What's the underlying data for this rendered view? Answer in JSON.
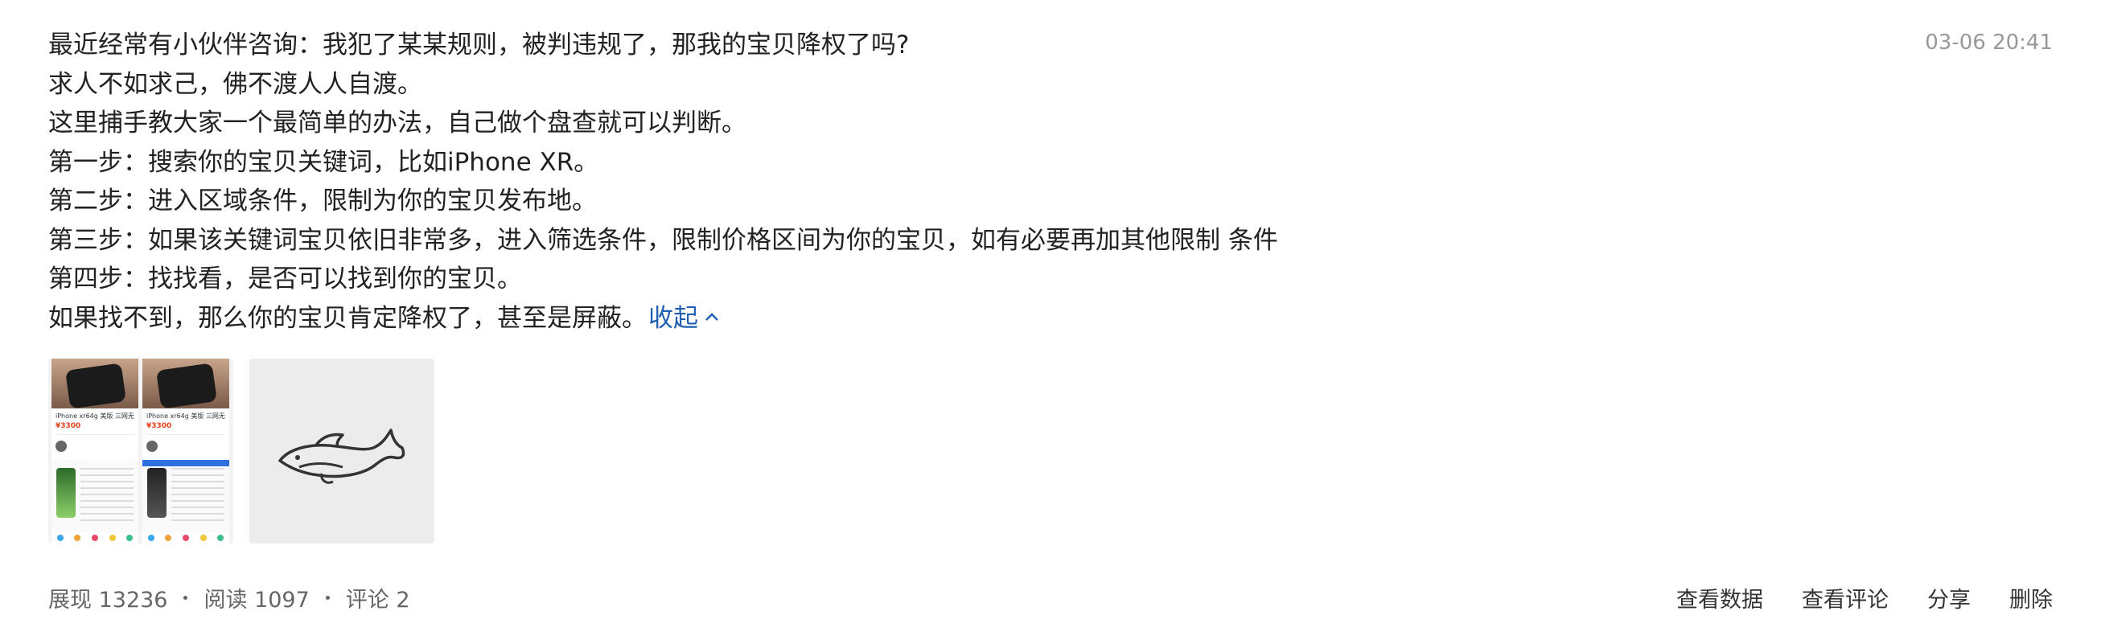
{
  "post": {
    "timestamp": "03-06 20:41",
    "lines": [
      "最近经常有小伙伴咨询：我犯了某某规则，被判违规了，那我的宝贝降权了吗?",
      "求人不如求己，佛不渡人人自渡。",
      "这里捕手教大家一个最简单的办法，自己做个盘查就可以判断。",
      "第一步：搜索你的宝贝关键词，比如iPhone XR。",
      "第二步：进入区域条件，限制为你的宝贝发布地。",
      "第三步：如果该关键词宝贝依旧非常多，进入筛选条件，限制价格区间为你的宝贝，如有必要再加其他限制 条件",
      "第四步：找找看，是否可以找到你的宝贝。",
      "如果找不到，那么你的宝贝肯定降权了，甚至是屏蔽。"
    ],
    "collapse_label": "收起",
    "collapse_icon": "chevron-up-icon",
    "link_color": "#1e5fb4"
  },
  "images": {
    "screenshot": {
      "left": {
        "title": "iPhone xr64g 美版 三网无",
        "price": "¥3300"
      },
      "right": {
        "title": "iPhone xr64g 美版 三网无",
        "price": "¥3300"
      }
    },
    "placeholder_icon": "whale-icon"
  },
  "footer": {
    "impressions": "展现 13236",
    "reads": "阅读 1097",
    "comments": "评论 2",
    "actions": {
      "view_data": "查看数据",
      "view_comments": "查看评论",
      "share": "分享",
      "delete": "删除"
    }
  }
}
